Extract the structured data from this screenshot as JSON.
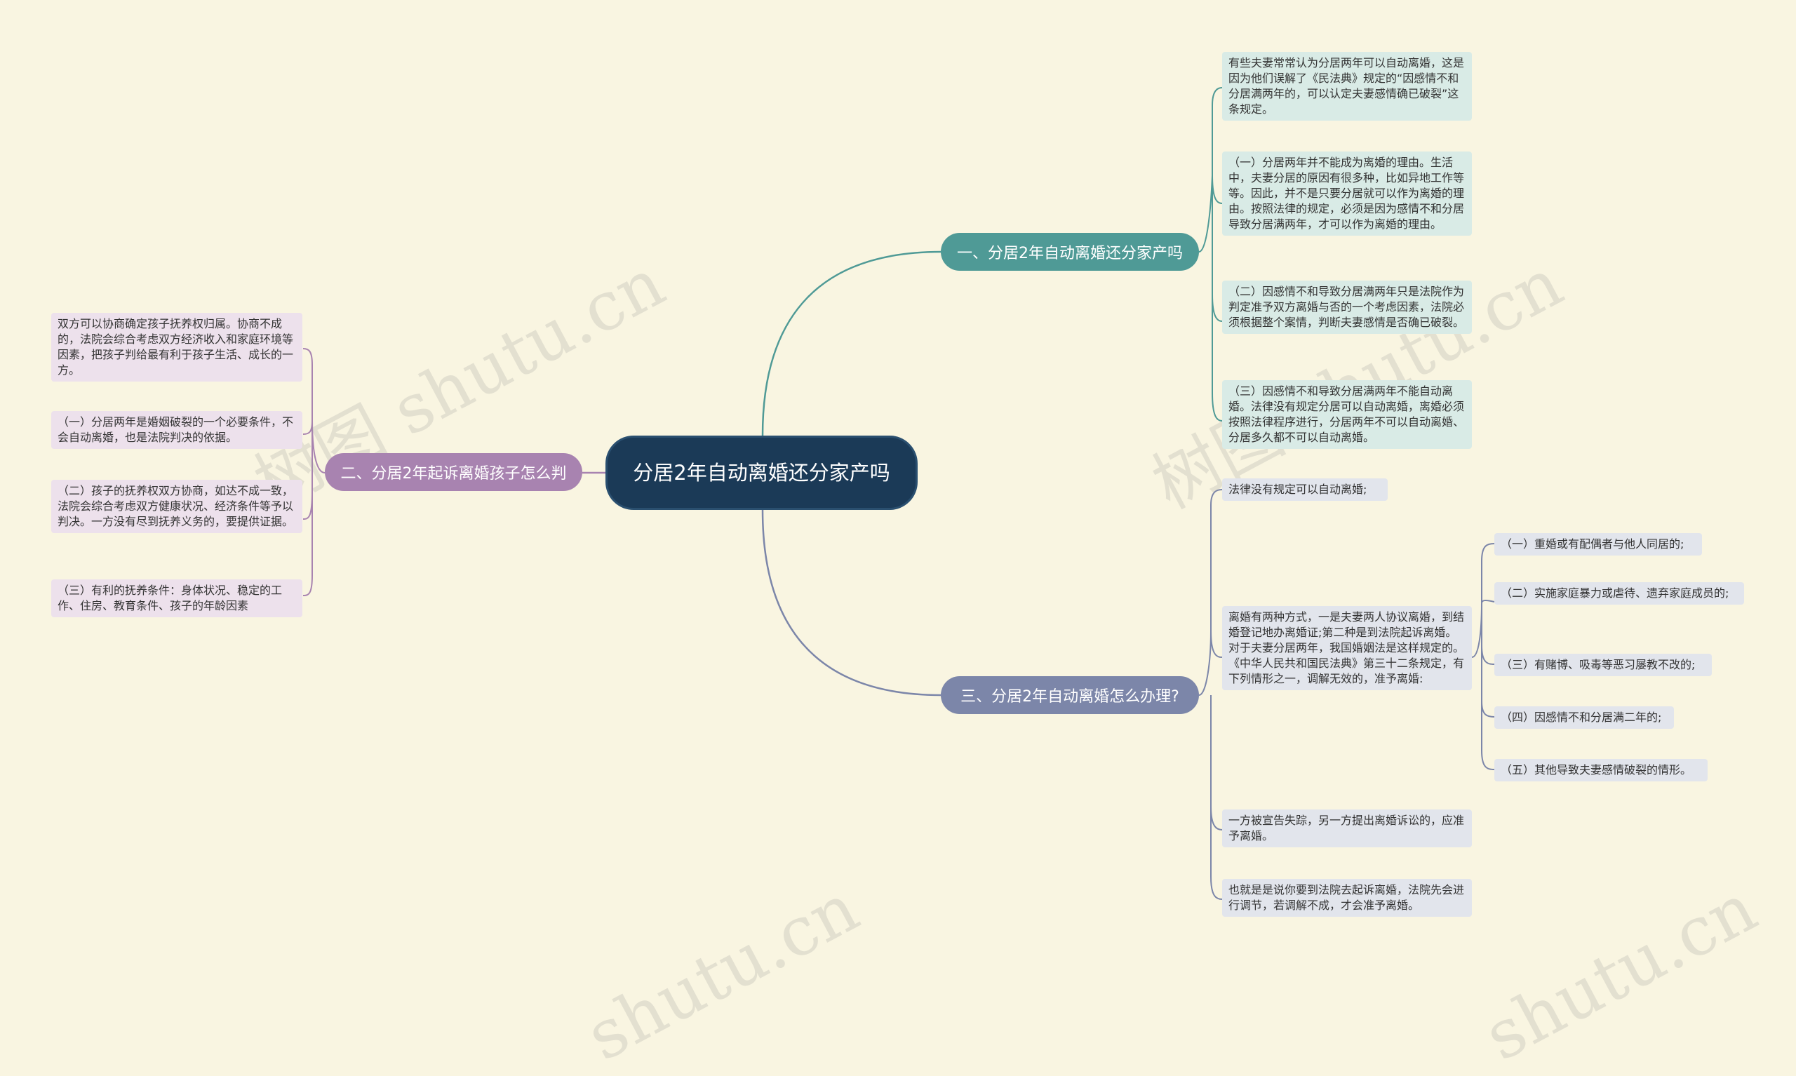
{
  "root": "分居2年自动离婚还分家产吗",
  "colors": {
    "background": "#f9f5e1",
    "root": "#1b3a57",
    "branch1": "#4f9a96",
    "branch2": "#a883b0",
    "branch3": "#7c86a9"
  },
  "branch1": {
    "label": "一、分居2年自动离婚还分家产吗",
    "items": [
      "有些夫妻常常认为分居两年可以自动离婚，这是因为他们误解了《民法典》规定的“因感情不和分居满两年的，可以认定夫妻感情确已破裂”这条规定。",
      "（一）分居两年并不能成为离婚的理由。生活中，夫妻分居的原因有很多种，比如异地工作等等。因此，并不是只要分居就可以作为离婚的理由。按照法律的规定，必须是因为感情不和分居导致分居满两年，才可以作为离婚的理由。",
      "（二）因感情不和导致分居满两年只是法院作为判定准予双方离婚与否的一个考虑因素，法院必须根据整个案情，判断夫妻感情是否确已破裂。",
      "（三）因感情不和导致分居满两年不能自动离婚。法律没有规定分居可以自动离婚，离婚必须按照法律程序进行，分居两年不可以自动离婚、分居多久都不可以自动离婚。"
    ]
  },
  "branch2": {
    "label": "二、分居2年起诉离婚孩子怎么判",
    "items": [
      "双方可以协商确定孩子抚养权归属。协商不成的，法院会综合考虑双方经济收入和家庭环境等因素，把孩子判给最有利于孩子生活、成长的一方。",
      "（一）分居两年是婚姻破裂的一个必要条件，不会自动离婚，也是法院判决的依据。",
      "（二）孩子的抚养权双方协商，如达不成一致，法院会综合考虑双方健康状况、经济条件等予以判决。一方没有尽到抚养义务的，要提供证据。",
      "（三）有利的抚养条件：身体状况、稳定的工作、住房、教育条件、孩子的年龄因素"
    ]
  },
  "branch3": {
    "label": "三、分居2年自动离婚怎么办理?",
    "items": [
      "法律没有规定可以自动离婚;",
      "离婚有两种方式，一是夫妻两人协议离婚，到结婚登记地办离婚证;第二种是到法院起诉离婚。对于夫妻分居两年，我国婚姻法是这样规定的。《中华人民共和国民法典》第三十二条规定，有下列情形之一，调解无效的，准予离婚:",
      "一方被宣告失踪，另一方提出离婚诉讼的，应准予离婚。",
      "也就是是说你要到法院去起诉离婚，法院先会进行调节，若调解不成，才会准予离婚。"
    ],
    "sub_items": [
      "（一）重婚或有配偶者与他人同居的;",
      "（二）实施家庭暴力或虐待、遗弃家庭成员的;",
      "（三）有赌博、吸毒等恶习屡教不改的;",
      "（四）因感情不和分居满二年的;",
      "（五）其他导致夫妻感情破裂的情形。"
    ]
  }
}
